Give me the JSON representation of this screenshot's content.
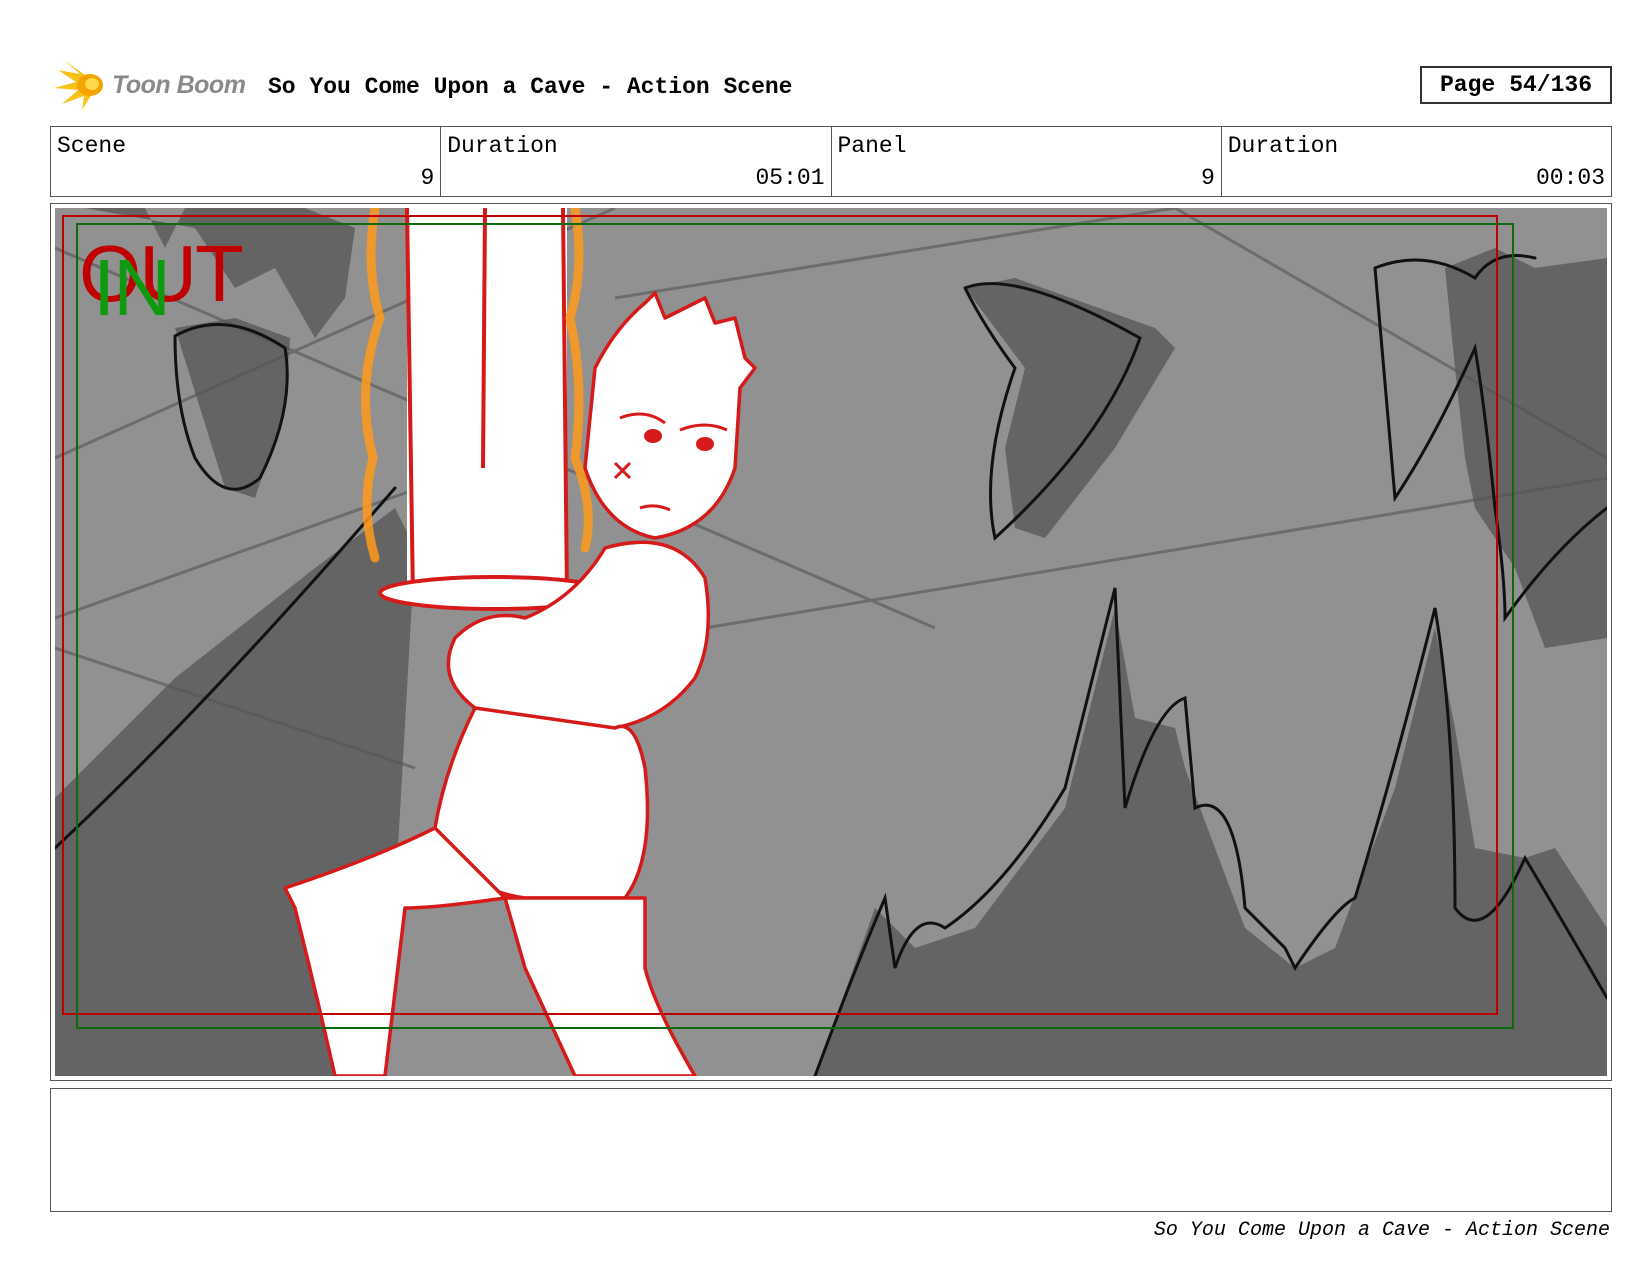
{
  "header": {
    "logo_text": "Toon Boom",
    "title": "So You Come Upon a Cave - Action Scene",
    "page_label": "Page",
    "page_value": "54/136"
  },
  "info": {
    "scene_label": "Scene",
    "scene_value": "9",
    "duration_label": "Duration",
    "duration_value": "05:01",
    "panel_label": "Panel",
    "panel_value": "9",
    "panel_duration_label": "Duration",
    "panel_duration_value": "00:03"
  },
  "panel": {
    "out_label": "OUT",
    "in_label": "IN",
    "out_color": "#c00000",
    "in_color": "#0e9a0e"
  },
  "notes": {
    "text": ""
  },
  "footer": {
    "title": "So You Come Upon a Cave - Action Scene"
  }
}
